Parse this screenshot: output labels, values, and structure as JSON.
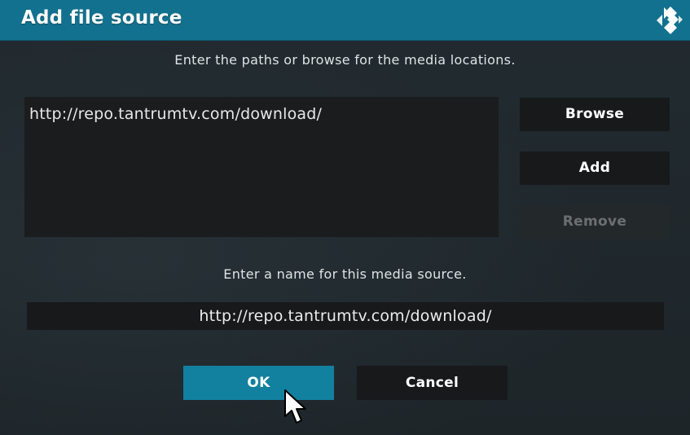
{
  "dialog": {
    "title": "Add file source",
    "logo_icon": "kodi-logo-icon",
    "paths_instruction": "Enter the paths or browse for the media locations.",
    "paths": [
      "http://repo.tantrumtv.com/download/"
    ],
    "side_buttons": {
      "browse": "Browse",
      "add": "Add",
      "remove": "Remove"
    },
    "name_instruction": "Enter a name for this media source.",
    "name_value": "http://repo.tantrumtv.com/download/",
    "ok_label": "OK",
    "cancel_label": "Cancel"
  },
  "colors": {
    "titlebar": "#12718f",
    "focused_button": "#12809f",
    "background": "#1f272b",
    "control": "#17191b",
    "disabled_text": "#6b6f72"
  },
  "cursor_icon": "mouse-pointer-icon"
}
